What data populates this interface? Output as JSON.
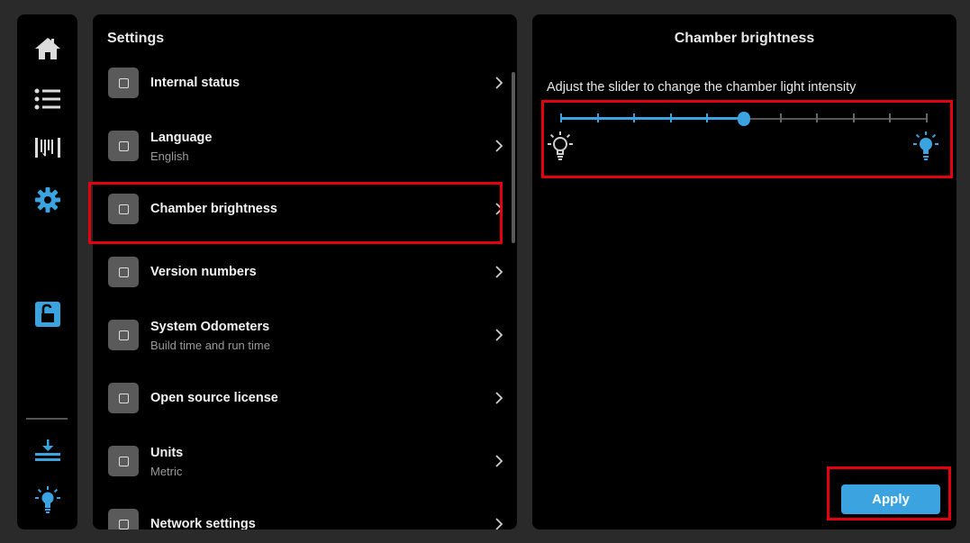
{
  "colors": {
    "accent": "#3ba4e0",
    "highlight": "#e3000f",
    "panel": "#000000",
    "icon_gray": "#5a5a5a"
  },
  "nav": {
    "items": [
      {
        "icon": "home-icon"
      },
      {
        "icon": "list-icon"
      },
      {
        "icon": "filament-icon"
      },
      {
        "icon": "gear-icon",
        "active": true
      },
      {
        "icon": "unlock-icon"
      },
      {
        "icon": "download-tray-icon"
      },
      {
        "icon": "lightbulb-icon"
      }
    ]
  },
  "settings": {
    "title": "Settings",
    "items": [
      {
        "label": "Internal status",
        "sublabel": ""
      },
      {
        "label": "Language",
        "sublabel": "English"
      },
      {
        "label": "Chamber brightness",
        "sublabel": "",
        "selected": true
      },
      {
        "label": "Version numbers",
        "sublabel": ""
      },
      {
        "label": "System Odometers",
        "sublabel": "Build time and run time"
      },
      {
        "label": "Open source license",
        "sublabel": ""
      },
      {
        "label": "Units",
        "sublabel": "Metric"
      },
      {
        "label": "Network settings",
        "sublabel": ""
      }
    ]
  },
  "detail": {
    "title": "Chamber brightness",
    "description": "Adjust the slider to change the chamber light intensity",
    "slider": {
      "steps": 10,
      "value": 5,
      "min_icon": "lightbulb-dim-icon",
      "max_icon": "lightbulb-bright-icon"
    },
    "apply_label": "Apply"
  }
}
